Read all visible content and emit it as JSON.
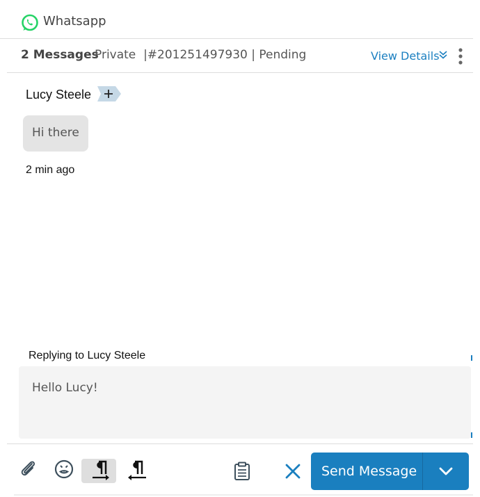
{
  "channel": {
    "name": "Whatsapp",
    "icon": "whatsapp-icon",
    "brand_color": "#25d366"
  },
  "conversation": {
    "message_count": "2 Messages",
    "meta": "Private  |#201251497930 | Pending",
    "view_details_label": "View Details",
    "more_icon": "more-vertical-icon"
  },
  "contact": {
    "name": "Lucy Steele",
    "add_icon": "plus-icon"
  },
  "messages": [
    {
      "text": "Hi there",
      "time": "2 min ago"
    }
  ],
  "reply": {
    "replying_to": "Replying to Lucy Steele",
    "text": "Hello Lucy!"
  },
  "toolbar": {
    "attach_icon": "paperclip-icon",
    "emoji_icon": "emoji-icon",
    "ltr_icon": "text-direction-ltr-icon",
    "rtl_icon": "text-direction-rtl-icon",
    "template_icon": "clipboard-icon",
    "cancel_icon": "close-icon",
    "send_label": "Send Message",
    "send_dropdown_icon": "chevron-down-icon",
    "accent_color": "#1a7fbf"
  }
}
